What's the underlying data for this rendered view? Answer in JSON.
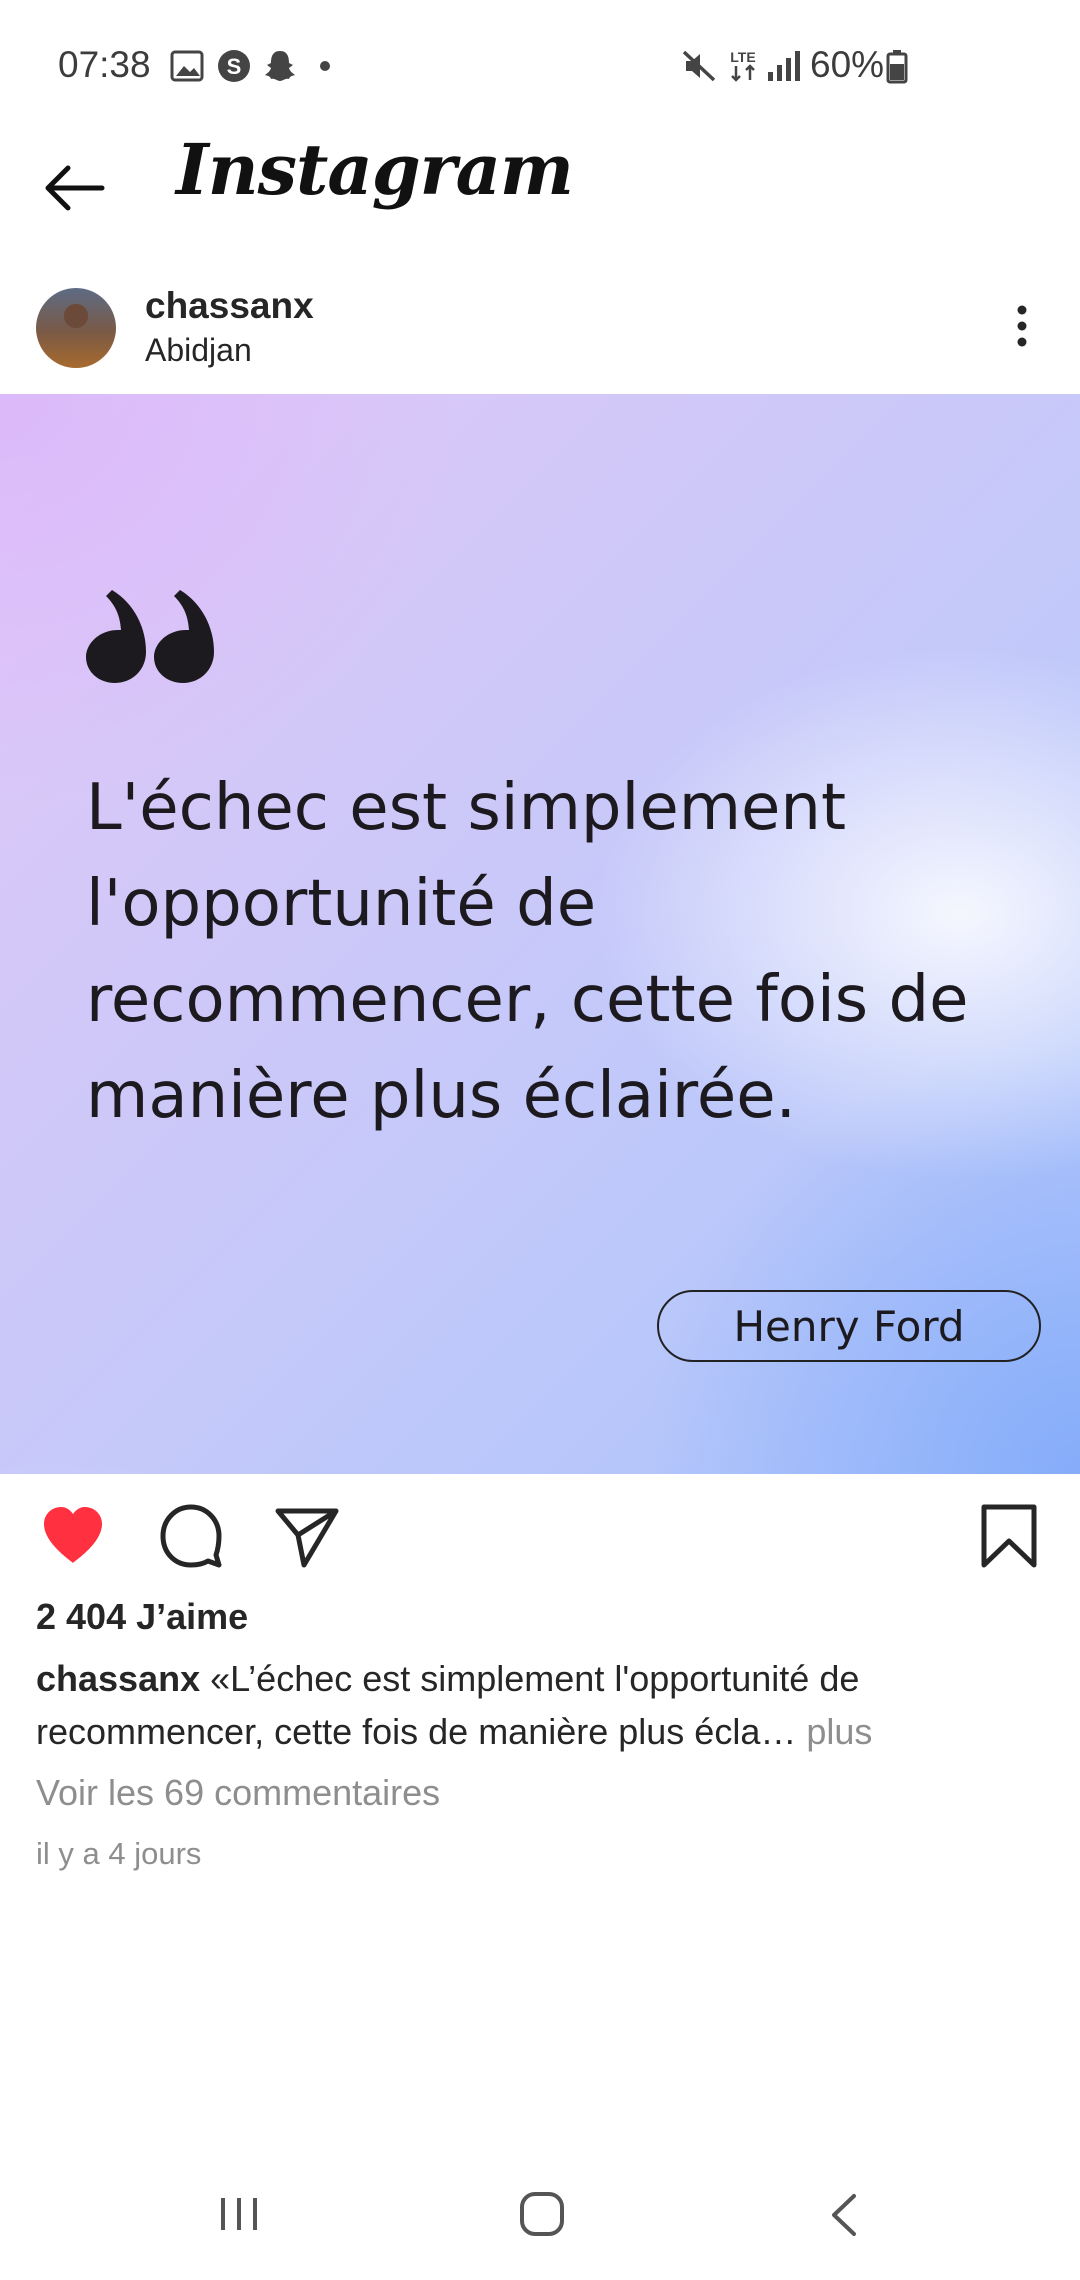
{
  "status_bar": {
    "time": "07:38",
    "battery": "60%",
    "network": "LTE",
    "left_icons": [
      "gallery-icon",
      "s-app-icon",
      "snapchat-icon",
      "dot-icon"
    ],
    "right_icons": [
      "mute-icon",
      "lte-icon",
      "signal-icon",
      "battery-icon"
    ]
  },
  "header": {
    "title": "Instagram"
  },
  "post": {
    "username": "chassanx",
    "location": "Abidjan",
    "image": {
      "quote": "L'échec est simplement l'opportunité de recommencer, cette fois de manière plus éclairée.",
      "author": "Henry Ford",
      "colors": [
        "#e2c8f8",
        "#cfc8f8",
        "#a9c3fb"
      ]
    },
    "likes": "2 404 J’aime",
    "caption_user": "chassanx",
    "caption_text": " «L’échec est simplement l'opportunité de recommencer, cette fois de manière plus écla…",
    "caption_more": " plus",
    "view_comments": "Voir les 69 commentaires",
    "time_ago": "il y a 4 jours",
    "liked": true,
    "accent": "#ff3040"
  }
}
